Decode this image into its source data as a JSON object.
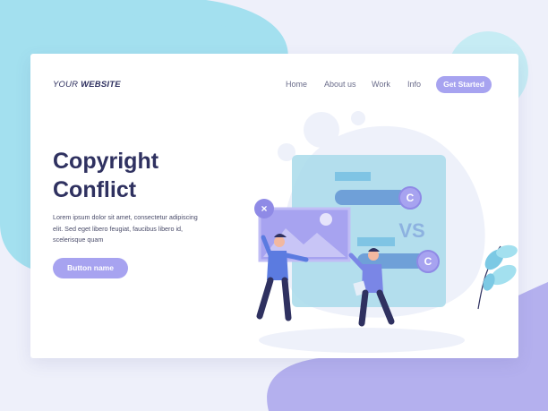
{
  "header": {
    "logo_prefix": "YOUR",
    "logo_bold": "WEBSITE",
    "nav": [
      {
        "label": "Home"
      },
      {
        "label": "About us"
      },
      {
        "label": "Work"
      },
      {
        "label": "Info"
      }
    ],
    "cta_label": "Get Started"
  },
  "hero": {
    "title_line1": "Copyright",
    "title_line2": "Conflict",
    "body_line1": "Lorem ipsum dolor sit amet, consectetur adipiscing",
    "body_line2": "elit. Sed eget libero feugiat, faucibus libero id,",
    "body_line3": "scelerisque quam",
    "button_label": "Button name"
  },
  "illustration": {
    "vs_label": "VS",
    "copyright_symbol": "C"
  },
  "colors": {
    "primary": "#2f3160",
    "accent": "#a7a3f0",
    "blue": "#6fa0d8",
    "cyan_blob": "#a3e0ef"
  }
}
